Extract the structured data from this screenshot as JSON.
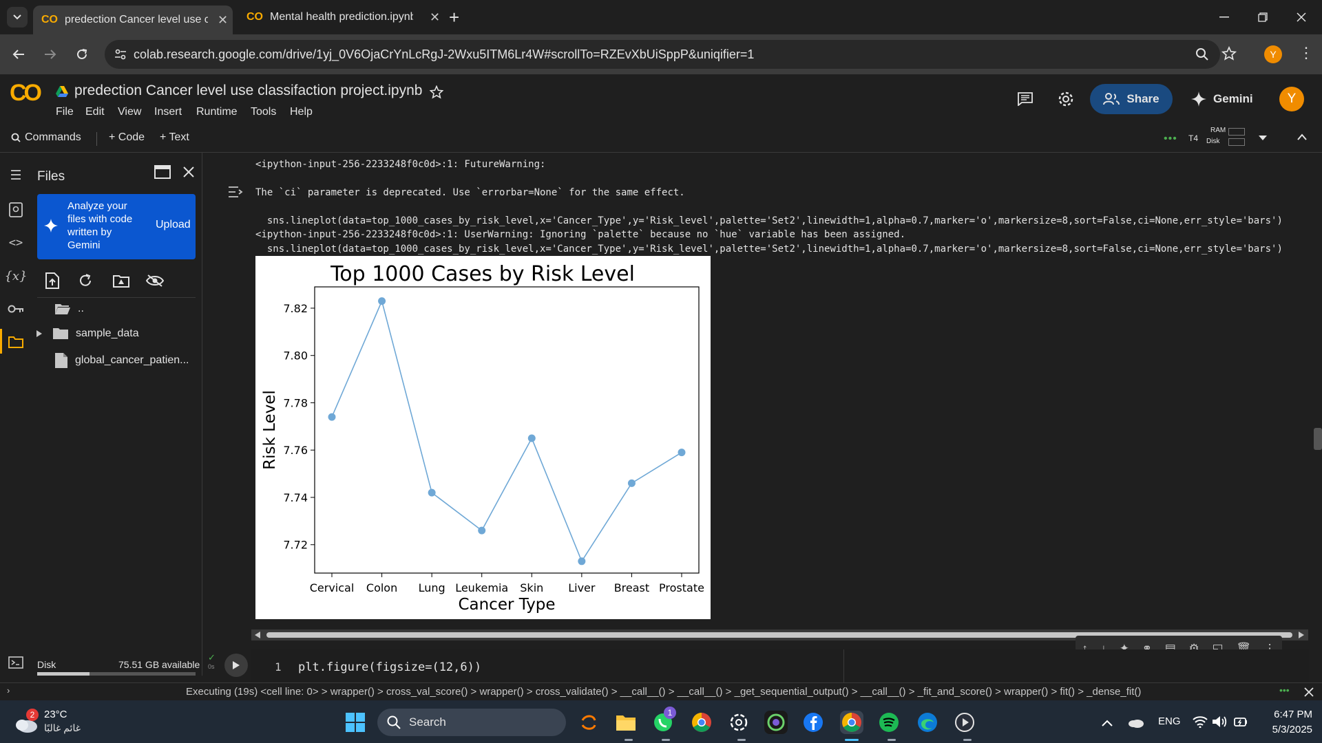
{
  "browser": {
    "tabs": [
      {
        "title": "predection Cancer level use cla",
        "active": true
      },
      {
        "title": "Mental health prediction.ipynb",
        "active": false
      }
    ],
    "url": "colab.research.google.com/drive/1yj_0V6OjaCrYnLcRgJ-2Wxu5ITM6Lr4W#scrollTo=RZEvXbUiSppP&uniqifier=1",
    "profile_initial": "Y"
  },
  "colab": {
    "logo": "CO",
    "notebook_title": "predection Cancer level use classifaction project.ipynb",
    "menu": [
      "File",
      "Edit",
      "View",
      "Insert",
      "Runtime",
      "Tools",
      "Help"
    ],
    "share_label": "Share",
    "gemini_label": "Gemini",
    "user_initial": "Y",
    "toolbar": {
      "commands": "Commands",
      "code": "+ Code",
      "text": "+ Text",
      "runtime": "T4",
      "ram": "RAM",
      "disk": "Disk"
    }
  },
  "files_panel": {
    "title": "Files",
    "gemini_prompt": "Analyze your files with code written by Gemini",
    "upload_label": "Upload",
    "items": [
      "..",
      "sample_data",
      "global_cancer_patien..."
    ],
    "disk_label": "Disk",
    "disk_available": "75.51 GB available"
  },
  "output": {
    "lines": [
      "<ipython-input-256-2233248f0c0d>:1: FutureWarning:",
      "The `ci` parameter is deprecated. Use `errorbar=None` for the same effect.",
      "  sns.lineplot(data=top_1000_cases_by_risk_level,x='Cancer_Type',y='Risk_level',palette='Set2',linewidth=1,alpha=0.7,marker='o',markersize=8,sort=False,ci=None,err_style='bars')",
      "<ipython-input-256-2233248f0c0d>:1: UserWarning: Ignoring `palette` because no `hue` variable has been assigned.",
      "  sns.lineplot(data=top_1000_cases_by_risk_level,x='Cancer_Type',y='Risk_level',palette='Set2',linewidth=1,alpha=0.7,marker='o',markersize=8,sort=False,ci=None,err_style='bars')"
    ]
  },
  "code_cell": {
    "line_number": "1",
    "code": "plt.figure(figsize=(12,6))"
  },
  "status": {
    "text": "Executing (19s) <cell line: 0> > wrapper() > cross_val_score() > wrapper() > cross_validate() > __call__() > __call__() > _get_sequential_output() > __call__() > _fit_and_score() > wrapper() > fit() > _dense_fit()"
  },
  "taskbar": {
    "weather_temp": "23°C",
    "weather_desc": "غائم غالبًا",
    "weather_badge": "2",
    "search_label": "Search",
    "lang": "ENG",
    "time": "6:47 PM",
    "date": "5/3/2025",
    "whatsapp_badge": "1"
  },
  "chart_data": {
    "type": "line",
    "title": "Top 1000 Cases by Risk Level",
    "xlabel": "Cancer Type",
    "ylabel": "Risk Level",
    "categories": [
      "Cervical",
      "Colon",
      "Lung",
      "Leukemia",
      "Skin",
      "Liver",
      "Breast",
      "Prostate"
    ],
    "values": [
      7.774,
      7.823,
      7.742,
      7.726,
      7.765,
      7.713,
      7.746,
      7.759
    ],
    "ylim": [
      7.708,
      7.829
    ],
    "yticks": [
      7.72,
      7.74,
      7.76,
      7.78,
      7.8,
      7.82
    ],
    "ytick_labels": [
      "7.72",
      "7.74",
      "7.76",
      "7.78",
      "7.80",
      "7.82"
    ],
    "line_color": "#6fa8d6",
    "grid": false
  }
}
